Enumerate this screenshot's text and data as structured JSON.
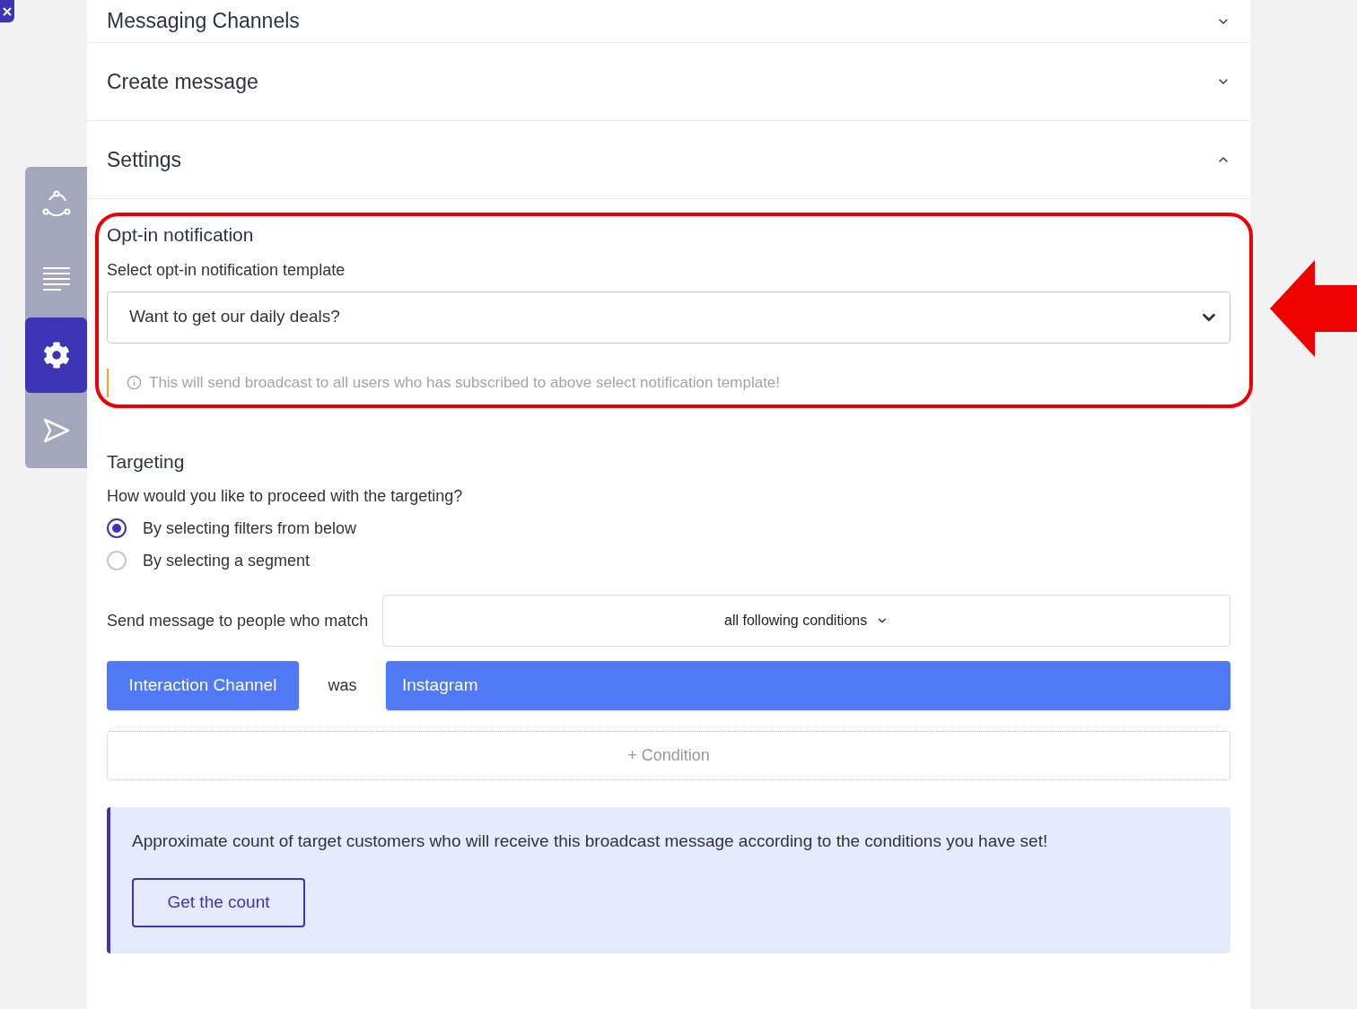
{
  "sections": [
    {
      "title": "Messaging Channels",
      "expanded": false
    },
    {
      "title": "Create message",
      "expanded": false
    },
    {
      "title": "Settings",
      "expanded": true
    }
  ],
  "sidebar": {
    "items": [
      {
        "kind": "nodes",
        "selected": false
      },
      {
        "kind": "lines",
        "selected": false
      },
      {
        "kind": "gear",
        "selected": true
      },
      {
        "kind": "send",
        "selected": false
      }
    ]
  },
  "opt_in": {
    "title": "Opt-in notification",
    "label": "Select opt-in notification template",
    "value": "Want to get our daily deals?",
    "note": "This will send broadcast to all users who has subscribed to above select notification template!"
  },
  "targeting": {
    "title": "Targeting",
    "question": "How would you like to proceed with the targeting?",
    "options": [
      {
        "label": "By selecting filters from below",
        "selected": true
      },
      {
        "label": "By selecting a segment",
        "selected": false
      }
    ],
    "match_label": "Send message to people who match",
    "match_value": "all following conditions",
    "condition": {
      "field": "Interaction Channel",
      "operator": "was",
      "value": "Instagram"
    },
    "add_condition": "+ Condition"
  },
  "count": {
    "text": "Approximate count of target customers who will receive this broadcast message according to the conditions you have set!",
    "button": "Get the count"
  }
}
